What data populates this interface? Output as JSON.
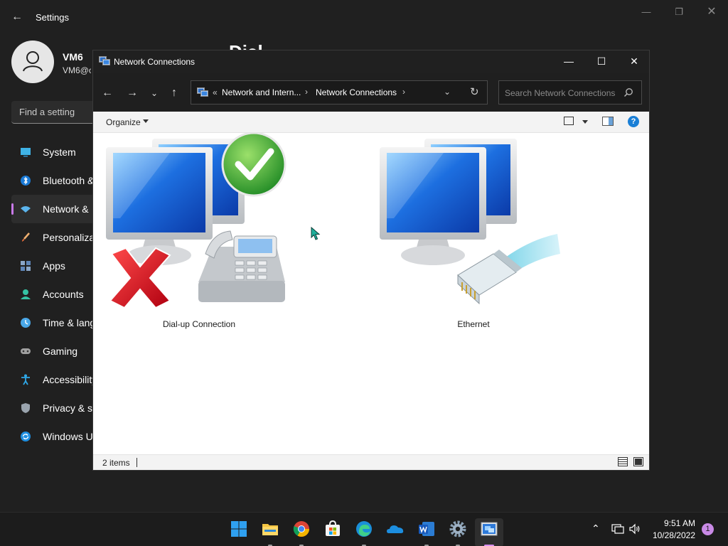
{
  "settings": {
    "title": "Settings",
    "user": {
      "name": "VM6",
      "email": "VM6@c"
    },
    "page_heading": "Dial",
    "search_placeholder": "Find a setting",
    "nav": [
      {
        "label": "System",
        "icon": "monitor-icon"
      },
      {
        "label": "Bluetooth &",
        "icon": "bluetooth-icon"
      },
      {
        "label": "Network &",
        "icon": "wifi-icon",
        "active": true
      },
      {
        "label": "Personaliza",
        "icon": "brush-icon"
      },
      {
        "label": "Apps",
        "icon": "apps-icon"
      },
      {
        "label": "Accounts",
        "icon": "person-icon"
      },
      {
        "label": "Time & lang",
        "icon": "clock-icon"
      },
      {
        "label": "Gaming",
        "icon": "gamepad-icon"
      },
      {
        "label": "Accessibility",
        "icon": "accessibility-icon"
      },
      {
        "label": "Privacy & se",
        "icon": "shield-icon"
      },
      {
        "label": "Windows U",
        "icon": "update-icon"
      }
    ]
  },
  "explorer": {
    "title": "Network Connections",
    "address": {
      "overflow": "«",
      "crumbs": [
        "Network and Intern...",
        "Network Connections"
      ]
    },
    "search_placeholder": "Search Network Connections",
    "organize_label": "Organize",
    "help_label": "?",
    "items": [
      {
        "label": "Dial-up Connection",
        "icon": "dialup-connection-icon",
        "status": "disconnected"
      },
      {
        "label": "Ethernet",
        "icon": "ethernet-connection-icon"
      }
    ],
    "status": "2 items"
  },
  "taskbar": {
    "apps": [
      "start-icon",
      "file-explorer-icon",
      "chrome-icon",
      "store-icon",
      "edge-icon",
      "onedrive-icon",
      "word-icon",
      "settings-icon",
      "network-connections-icon"
    ],
    "time": "9:51 AM",
    "date": "10/28/2022",
    "notifications": "1"
  },
  "colors": {
    "accent": "#c97ae8",
    "window_bg": "#202020",
    "content_bg": "#ffffff"
  }
}
